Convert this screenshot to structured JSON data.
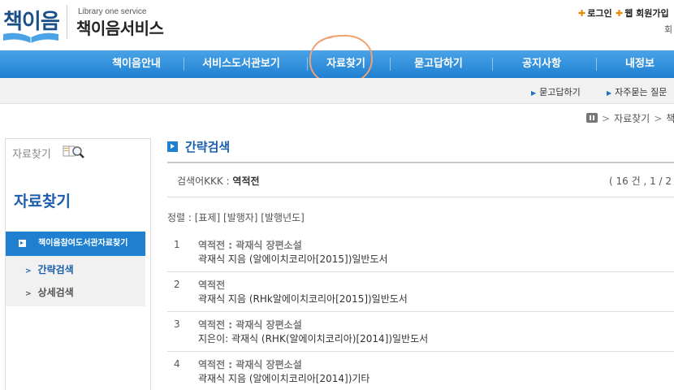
{
  "header": {
    "logo_text": "책이음",
    "logo_subtitle": "Library one service",
    "logo_title": "책이음서비스",
    "util_login": "로그인",
    "util_join": "웹 회원가입",
    "util_extra": "회"
  },
  "gnb": {
    "items": [
      "책이음안내",
      "서비스도서관보기",
      "자료찾기",
      "묻고답하기",
      "공지사항",
      "내정보"
    ]
  },
  "subgnb": {
    "items": [
      "묻고답하기",
      "자주묻는 질문"
    ]
  },
  "breadcrumb": {
    "current": "자료찾기",
    "next": "책"
  },
  "sidebar": {
    "head_label": "자료찾기",
    "title": "자료찾기",
    "menu_label": "책이음참여도서관자료찾기",
    "sub_items": [
      "간략검색",
      "상세검색"
    ]
  },
  "main": {
    "title": "간략검색",
    "search_label": "검색어KKK : ",
    "search_term": "역적전",
    "count_text": "( 16 건 , 1 / 2",
    "sort_label": "정렬 : [표제] [발행자] [발행년도]"
  },
  "results": [
    {
      "num": "1",
      "title": "역적전 : 곽재식 장편소설",
      "desc": "곽재식 지음 (알에이치코리아[2015])일반도서"
    },
    {
      "num": "2",
      "title": "역적전",
      "desc": "곽재식 지음 (RHk알에이치코리아[2015])일반도서"
    },
    {
      "num": "3",
      "title": "역적전 : 곽재식 장편소설",
      "desc": "지은이: 곽재식 (RHK(알에이치코리아)[2014])일반도서"
    },
    {
      "num": "4",
      "title": "역적전 : 곽재식 장편소설",
      "desc": "곽재식 지음 (알에이치코리아[2014])기타"
    }
  ],
  "colors": {
    "brand_blue": "#1f80d2",
    "title_blue": "#1b5eab",
    "util_orange": "#e98a00",
    "annotation": "#f2a070"
  }
}
